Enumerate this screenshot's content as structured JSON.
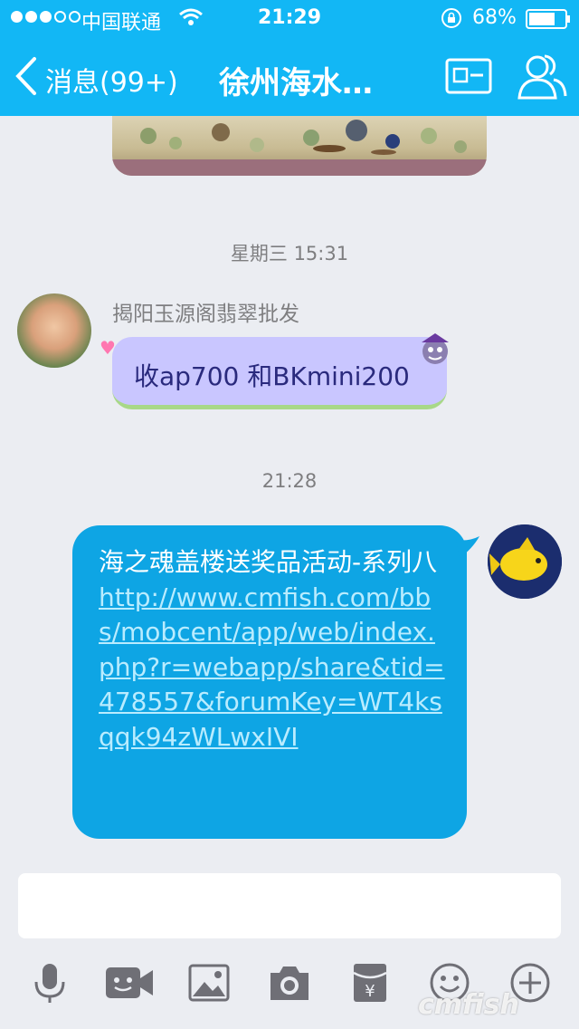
{
  "status_bar": {
    "carrier": "中国联通",
    "time": "21:29",
    "battery_percent": "68%"
  },
  "nav": {
    "back_label": "消息(99+)",
    "title": "徐州海水…"
  },
  "chat": {
    "timestamp_1": "星期三 15:31",
    "sender_name": "揭阳玉源阁翡翠批发",
    "incoming_message": "收ap700 和BKmini200",
    "timestamp_2": "21:28",
    "outgoing_message": "海之魂盖楼送奖品活动-系列八 ",
    "outgoing_link": "http://www.cmfish.com/bbs/mobcent/app/web/index.php?r=webapp/share&tid=478557&forumKey=WT4ksqqk94zWLwxIVI"
  },
  "watermark": "cmfish",
  "icons": [
    "wifi-icon",
    "lock-rotation-icon",
    "battery-icon",
    "back-icon",
    "contact-card-icon",
    "profile-icon",
    "microphone-icon",
    "video-icon",
    "image-icon",
    "camera-icon",
    "red-packet-icon",
    "emoji-icon",
    "plus-icon"
  ],
  "colors": {
    "header": "#12b7f5",
    "outgoing_bubble": "#0ea5e4",
    "incoming_bubble": "#c9c6ff",
    "background": "#ebedf2"
  }
}
